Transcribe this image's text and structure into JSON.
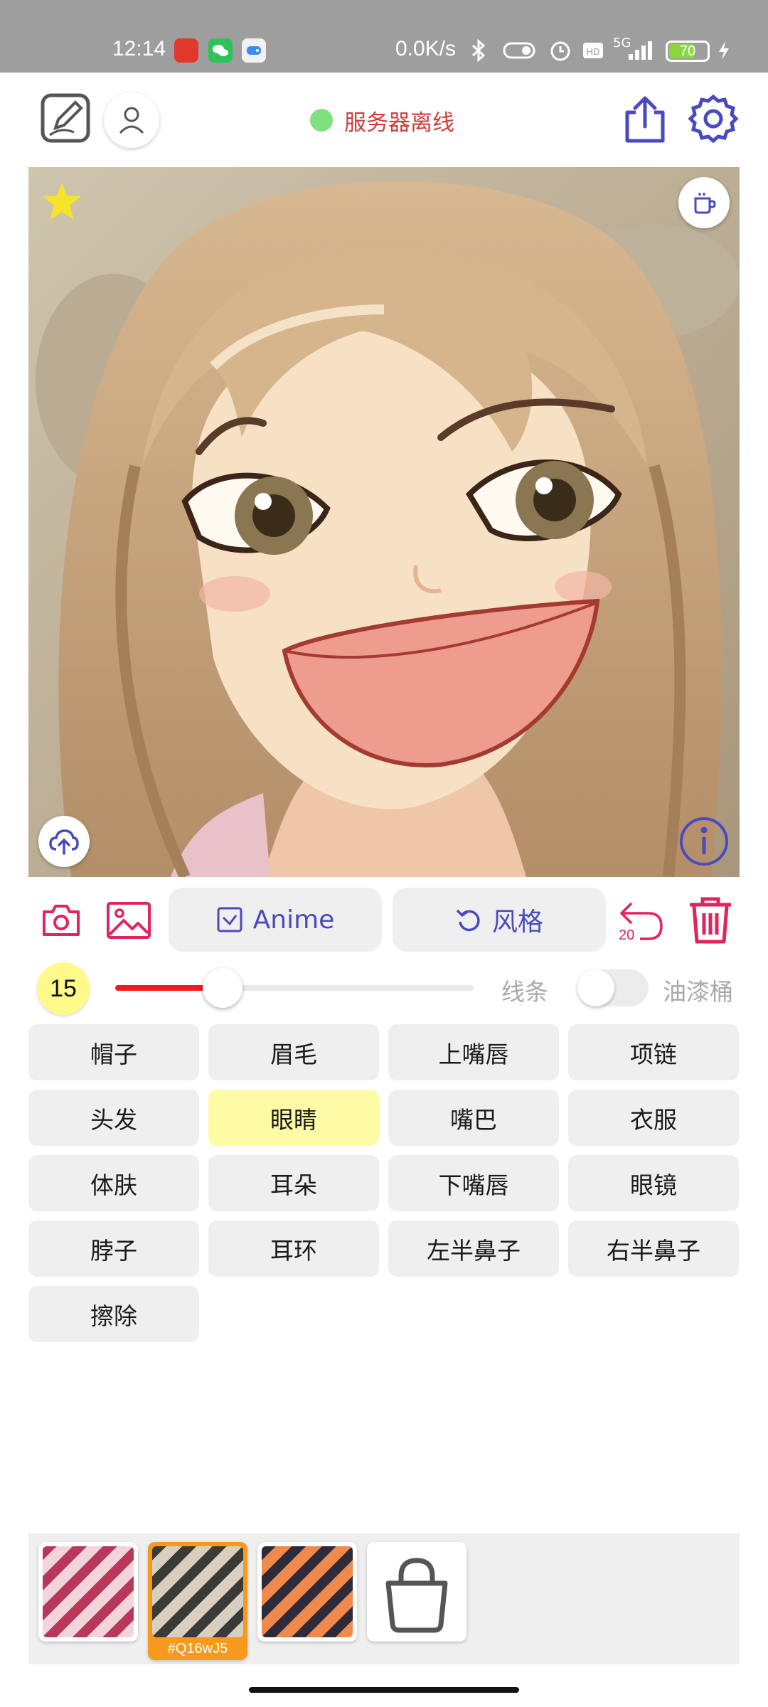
{
  "status_bar": {
    "time": "12:14",
    "network_speed": "0.0K/s",
    "signal_label": "5G",
    "battery_level": "70",
    "battery_fraction": 0.7,
    "icons": [
      "news-app-icon",
      "wechat-icon",
      "game-app-icon",
      "bluetooth-icon",
      "toggle-icon",
      "alarm-icon",
      "hd-icon",
      "signal-icon",
      "battery-icon",
      "charging-icon"
    ]
  },
  "header": {
    "server_status": "服务器离线",
    "server_status_color": "#d03a3a",
    "status_dot_color": "#7ee07e",
    "icons": [
      "sketch-edit-icon",
      "user-icon",
      "share-icon",
      "settings-icon"
    ]
  },
  "canvas": {
    "icons": [
      "star-icon",
      "coffee-cup-icon",
      "cloud-upload-icon",
      "info-icon"
    ]
  },
  "toolbar": {
    "anime_label": "Anime",
    "style_label": "风格",
    "undo_count": "20",
    "accent_color": "#e0245e",
    "button_text_color": "#4a4abe",
    "icons": [
      "camera-icon",
      "gallery-icon",
      "checkbox-icon",
      "rotate-icon",
      "undo-icon",
      "trash-icon"
    ]
  },
  "brush": {
    "size": "15",
    "slider_fraction": 0.3,
    "line_label": "线条",
    "bucket_label": "油漆桶",
    "bucket_enabled": false
  },
  "tags": [
    {
      "label": "帽子",
      "selected": false
    },
    {
      "label": "眉毛",
      "selected": false
    },
    {
      "label": "上嘴唇",
      "selected": false
    },
    {
      "label": "项链",
      "selected": false
    },
    {
      "label": "头发",
      "selected": false
    },
    {
      "label": "眼睛",
      "selected": true
    },
    {
      "label": "嘴巴",
      "selected": false
    },
    {
      "label": "衣服",
      "selected": false
    },
    {
      "label": "体肤",
      "selected": false
    },
    {
      "label": "耳朵",
      "selected": false
    },
    {
      "label": "下嘴唇",
      "selected": false
    },
    {
      "label": "眼镜",
      "selected": false
    },
    {
      "label": "脖子",
      "selected": false
    },
    {
      "label": "耳环",
      "selected": false
    },
    {
      "label": "左半鼻子",
      "selected": false
    },
    {
      "label": "右半鼻子",
      "selected": false
    },
    {
      "label": "擦除",
      "selected": false
    }
  ],
  "palette": {
    "swatches": [
      {
        "code": "",
        "selected": false,
        "colors": [
          "#b8385a",
          "#f3d4dc"
        ]
      },
      {
        "code": "#Q16wJ5",
        "selected": true,
        "colors": [
          "#3a3a36",
          "#d8cfbe"
        ]
      },
      {
        "code": "",
        "selected": false,
        "colors": [
          "#2f2a3a",
          "#ef8a4c"
        ]
      }
    ],
    "store_icon": "shopping-bag-icon"
  }
}
